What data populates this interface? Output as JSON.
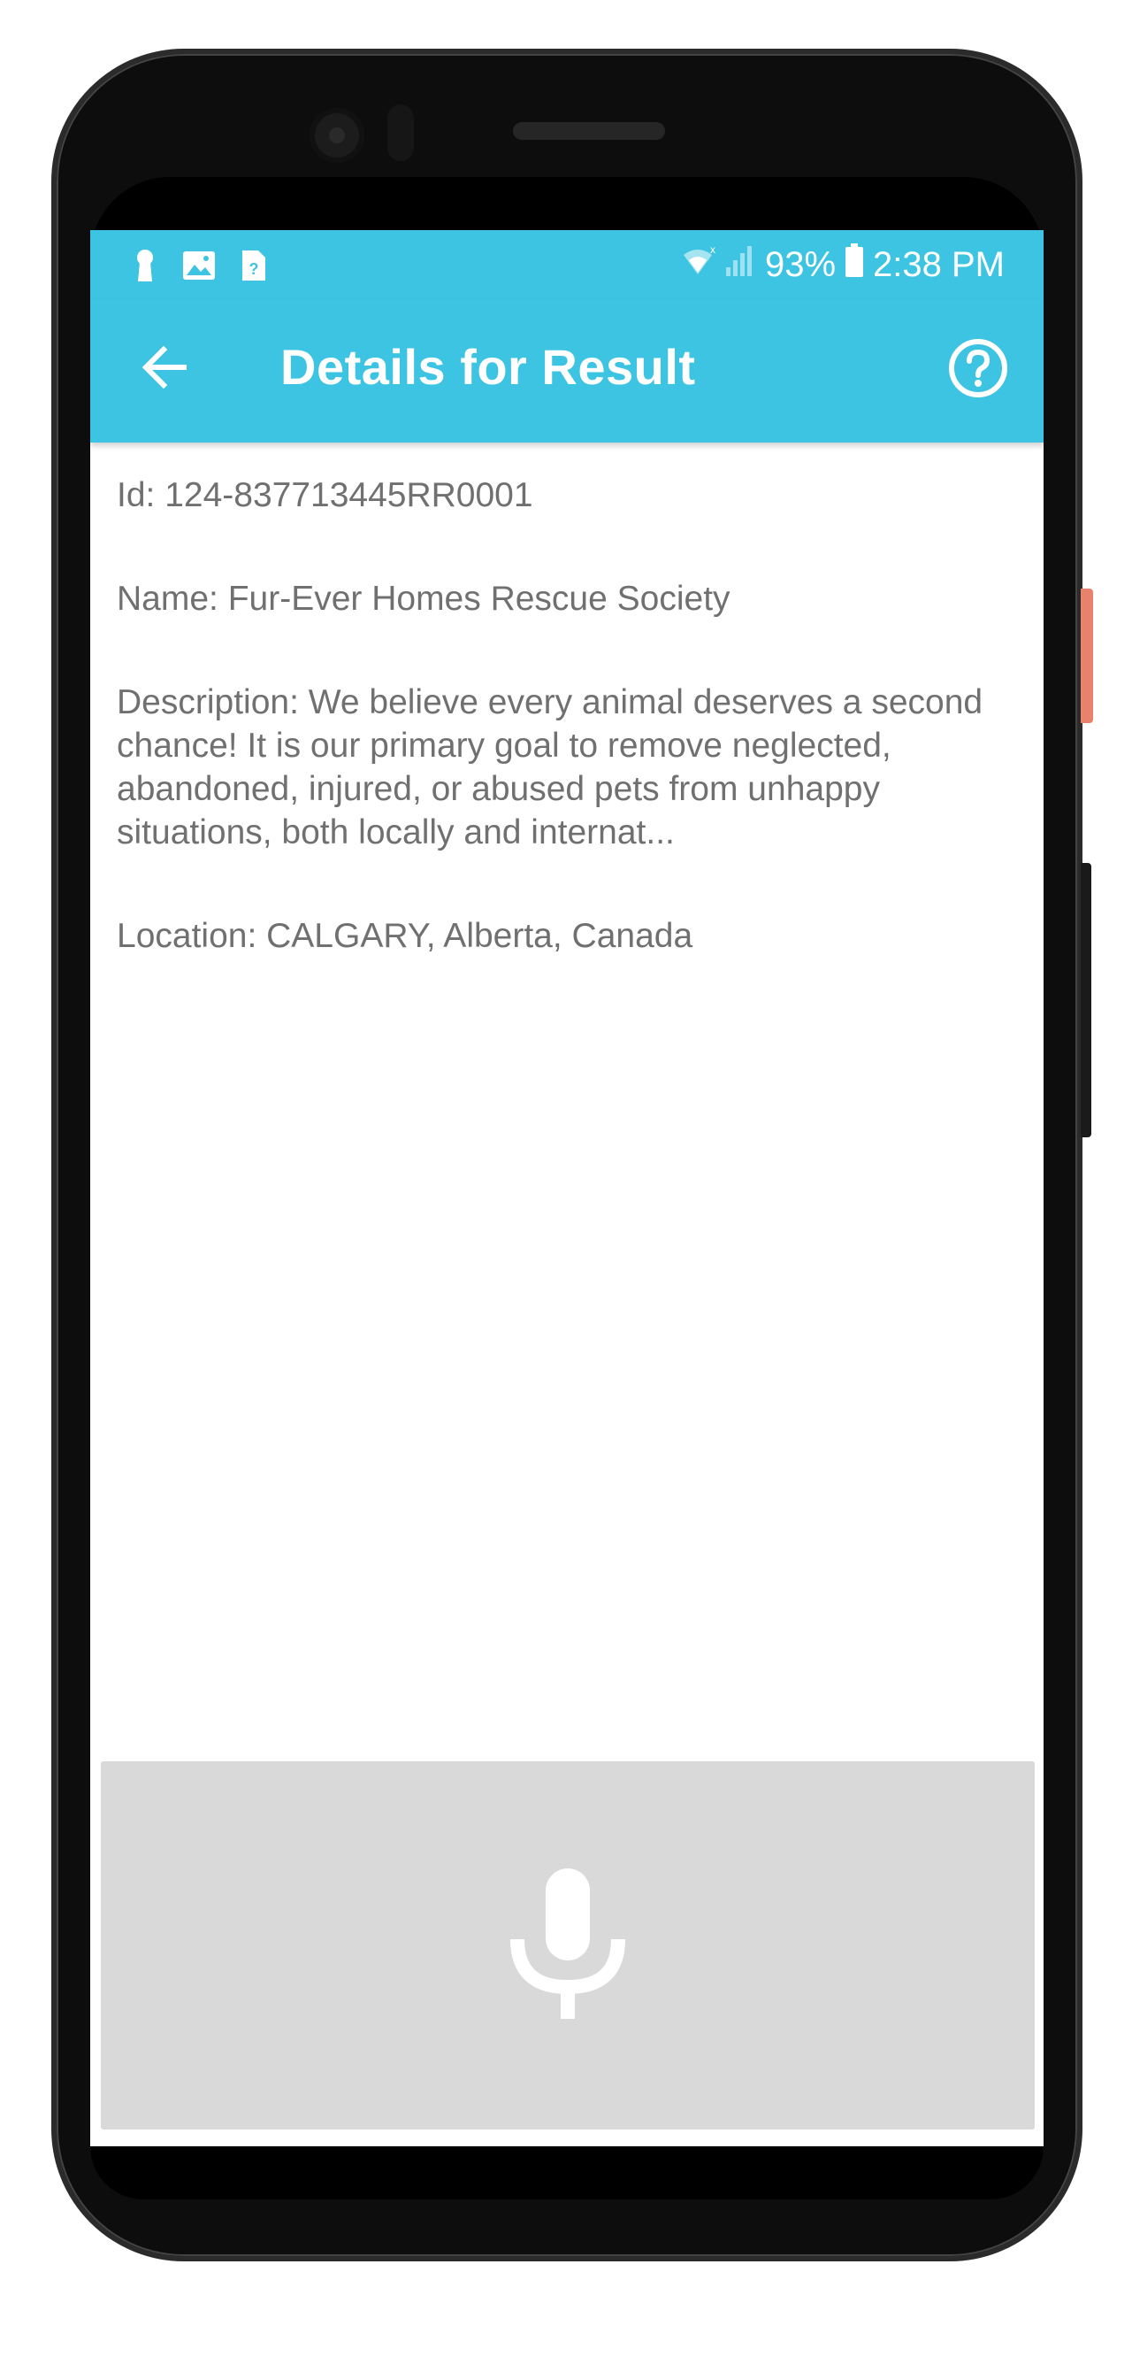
{
  "status_bar": {
    "battery": "93%",
    "time": "2:38 PM",
    "left_icons": [
      "keyhole-icon",
      "image-icon",
      "unknown-file-icon"
    ],
    "right_icons": [
      "wifi-off-icon",
      "signal-icon",
      "battery-icon"
    ]
  },
  "app_bar": {
    "title": "Details for Result",
    "back_icon": "arrow-left-icon",
    "help_icon": "help-circle-icon"
  },
  "details": {
    "id": "Id: 124-837713445RR0001",
    "name": "Name: Fur-Ever Homes Rescue Society",
    "description": "Description: We believe every animal deserves a second chance!  It is our primary goal to remove neglected, abandoned, injured, or abused pets from unhappy situations, both locally and internat...",
    "location": "Location: CALGARY, Alberta, Canada"
  },
  "voice_panel": {
    "icon": "microphone-icon"
  },
  "colors": {
    "accent": "#3dc4e2",
    "text": "#707070",
    "panel": "#d8d9d8"
  }
}
